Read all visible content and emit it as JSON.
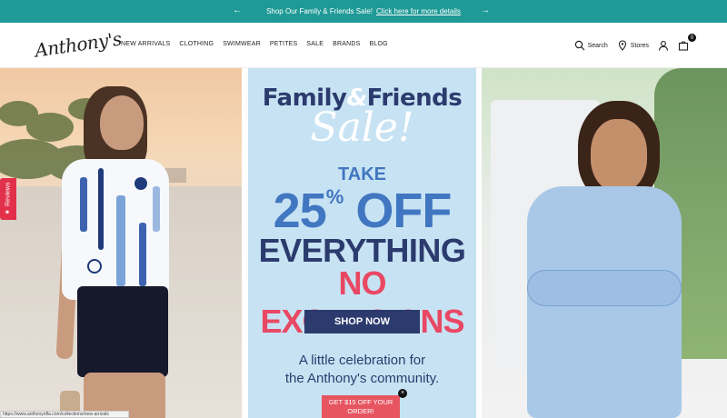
{
  "announcement": {
    "text": "Shop Our Family & Friends Sale!",
    "link": "Click here for more details",
    "prev_icon": "arrow-left-icon",
    "next_icon": "arrow-right-icon"
  },
  "header": {
    "logo": "Anthony's",
    "nav": [
      "NEW ARRIVALS",
      "CLOTHING",
      "SWIMWEAR",
      "PETITES",
      "SALE",
      "BRANDS",
      "BLOG"
    ],
    "search_label": "Search",
    "stores_label": "Stores",
    "cart_count": "0"
  },
  "promo": {
    "family": "Family",
    "amp": "&",
    "friends": "Friends",
    "sale": "Sale!",
    "take": "TAKE",
    "percent": "25",
    "percent_sign": "%",
    "off": "OFF",
    "everything": "EVERYTHING",
    "no_exclusions": "NO EXCLUSIONS",
    "button": "SHOP NOW",
    "celebration_line1": "A little celebration for",
    "celebration_line2": "the Anthony's community."
  },
  "reviews_tab": {
    "label": "Reviews",
    "icon": "star-icon"
  },
  "popup": {
    "line1": "GET $15 OFF YOUR",
    "line2": "ORDER!",
    "close": "×"
  },
  "statusbar": {
    "url": "https://www.anthonyofla.com/collections/new-arrivals"
  },
  "colors": {
    "teal": "#1f9a96",
    "navy": "#2c3b6e",
    "blue": "#4176c1",
    "pink": "#e94864",
    "promo_bg": "#c7e3f3"
  }
}
